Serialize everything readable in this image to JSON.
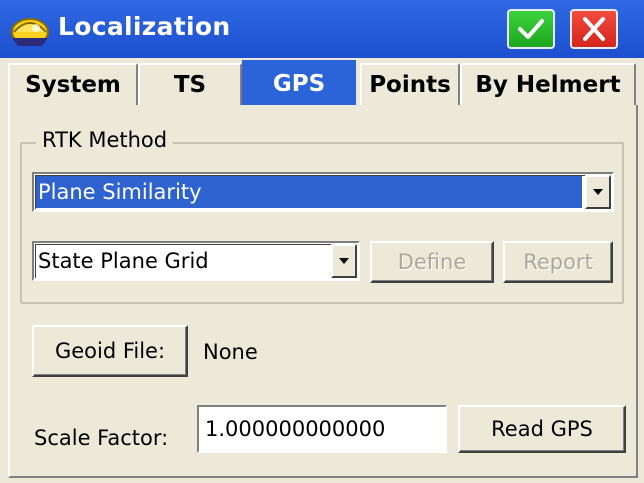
{
  "window": {
    "title": "Localization"
  },
  "tabs": [
    {
      "label": "System"
    },
    {
      "label": "TS"
    },
    {
      "label": "GPS",
      "active": true
    },
    {
      "label": "Points"
    },
    {
      "label": "By Helmert"
    }
  ],
  "rtk_method": {
    "group_label": "RTK Method",
    "method_value": "Plane Similarity",
    "grid_value": "State Plane Grid",
    "define_label": "Define",
    "report_label": "Report"
  },
  "geoid": {
    "button_label": "Geoid File:",
    "value": "None"
  },
  "scale": {
    "label": "Scale Factor:",
    "value": "1.000000000000",
    "read_gps_label": "Read GPS"
  },
  "colors": {
    "titlebar": "#2f69e2",
    "selection": "#2d62cf",
    "ok_green": "#1ea61e",
    "close_red": "#d3251c"
  },
  "icons": [
    "app-icon",
    "checkmark-icon",
    "close-icon",
    "dropdown-arrow-icon"
  ]
}
